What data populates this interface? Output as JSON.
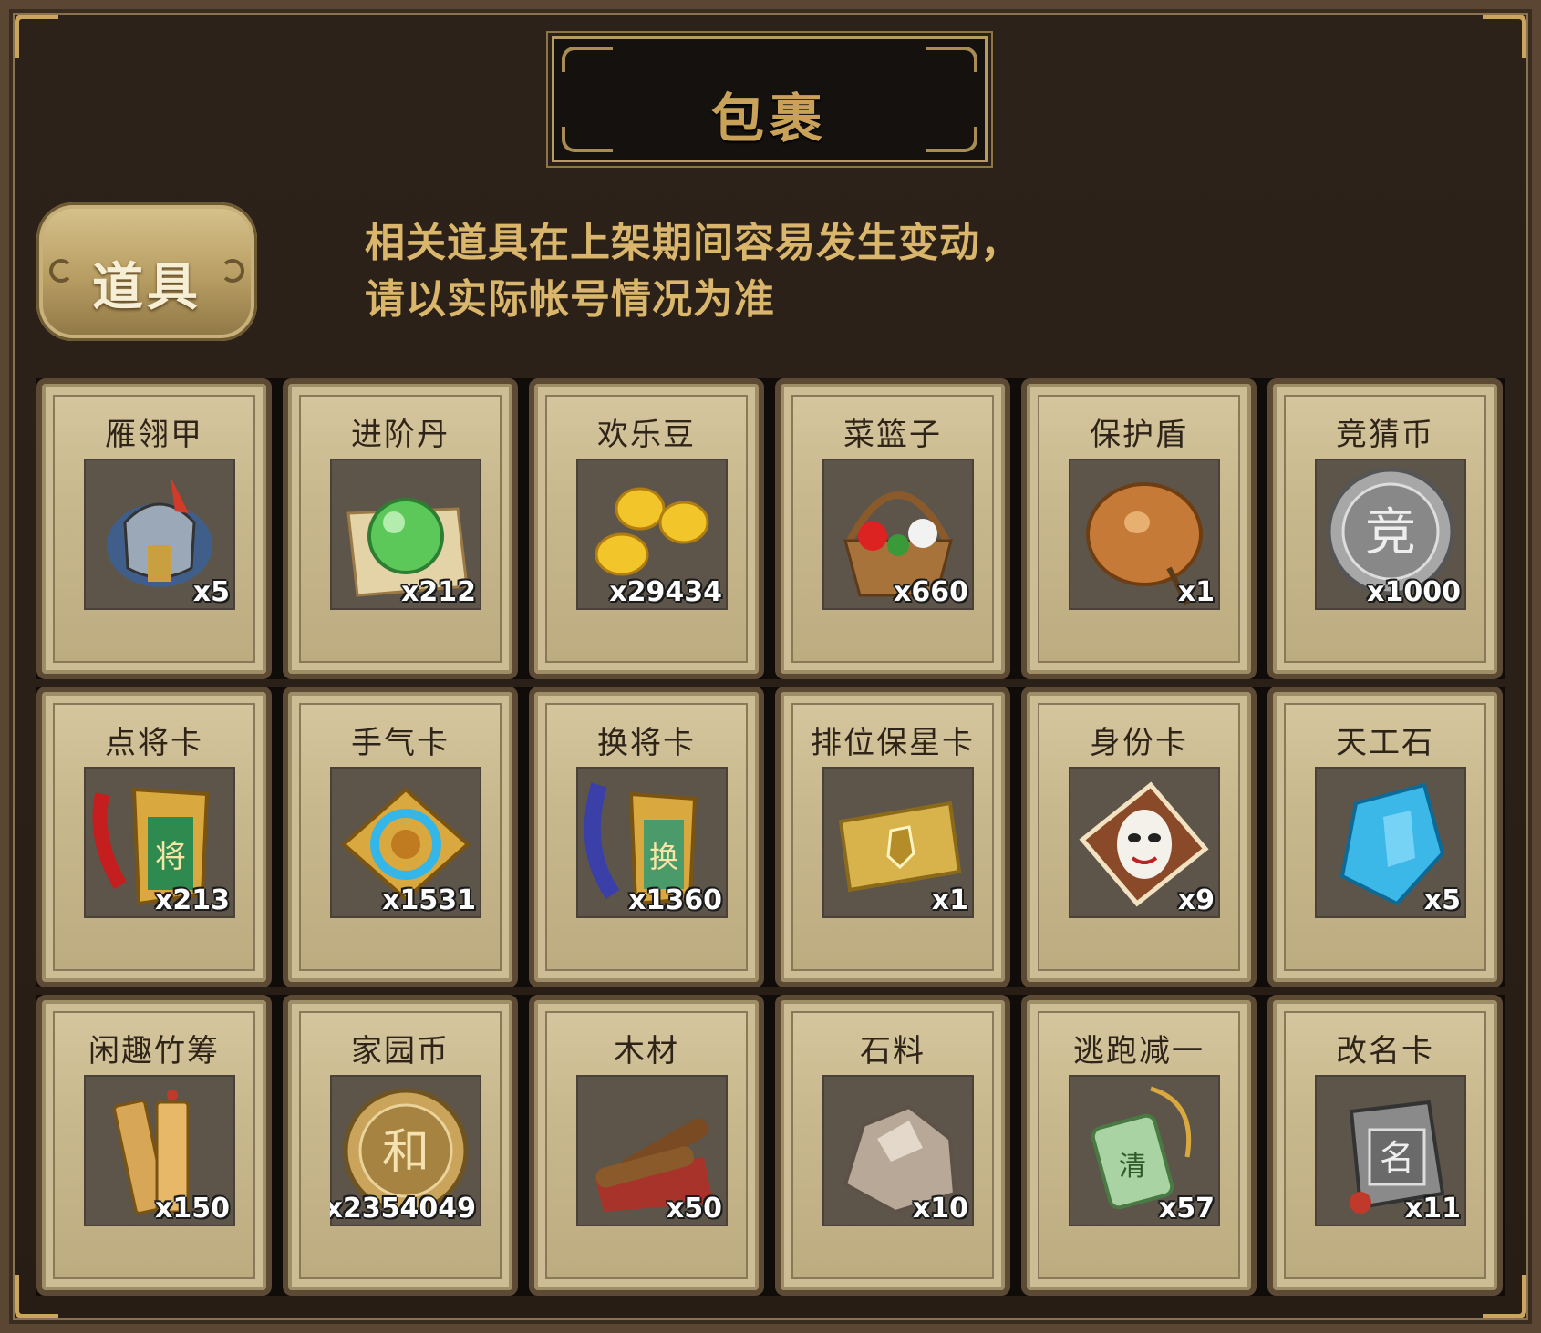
{
  "window": {
    "title": "包裹"
  },
  "tab": {
    "label": "道具"
  },
  "notice": {
    "line1": "相关道具在上架期间容易发生变动，",
    "line2": "请以实际帐号情况为准"
  },
  "items": [
    {
      "name": "雁翎甲",
      "count": "x5",
      "icon": "armor-helmet-icon"
    },
    {
      "name": "进阶丹",
      "count": "x212",
      "icon": "green-orb-icon"
    },
    {
      "name": "欢乐豆",
      "count": "x29434",
      "icon": "gold-beans-icon"
    },
    {
      "name": "菜篮子",
      "count": "x660",
      "icon": "flower-basket-icon"
    },
    {
      "name": "保护盾",
      "count": "x1",
      "icon": "shield-icon"
    },
    {
      "name": "竞猜币",
      "count": "x1000",
      "icon": "silver-coin-icon"
    },
    {
      "name": "点将卡",
      "count": "x213",
      "icon": "general-token-icon"
    },
    {
      "name": "手气卡",
      "count": "x1531",
      "icon": "luck-card-icon"
    },
    {
      "name": "换将卡",
      "count": "x1360",
      "icon": "swap-token-icon"
    },
    {
      "name": "排位保星卡",
      "count": "x1",
      "icon": "gold-card-icon"
    },
    {
      "name": "身份卡",
      "count": "x9",
      "icon": "mask-card-icon"
    },
    {
      "name": "天工石",
      "count": "x5",
      "icon": "blue-crystal-icon"
    },
    {
      "name": "闲趣竹筹",
      "count": "x150",
      "icon": "bamboo-tags-icon"
    },
    {
      "name": "家园币",
      "count": "x2354049",
      "icon": "gold-coin-icon"
    },
    {
      "name": "木材",
      "count": "x50",
      "icon": "wood-icon"
    },
    {
      "name": "石料",
      "count": "x10",
      "icon": "stone-icon"
    },
    {
      "name": "逃跑减一",
      "count": "x57",
      "icon": "jade-pendant-icon"
    },
    {
      "name": "改名卡",
      "count": "x11",
      "icon": "name-token-icon"
    }
  ],
  "colors": {
    "accent_gold": "#c9a25a",
    "notice_text": "#d9b66b",
    "card_bg": "#c8b88d",
    "frame_bg": "#2a2018"
  }
}
